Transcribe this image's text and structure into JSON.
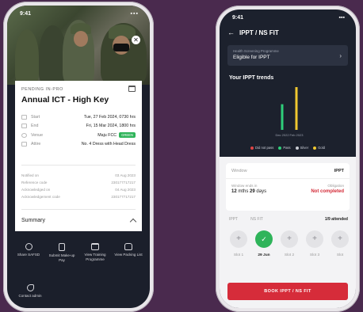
{
  "left_phone": {
    "status_bar": {
      "time": "9:41",
      "signals": "▪▪▪"
    },
    "event": {
      "status": "PENDING IN-PRO",
      "title": "Annual ICT - High Key",
      "details": [
        {
          "label": "Start",
          "value": "Tue, 27 Feb 2024, 0730 hrs"
        },
        {
          "label": "End",
          "value": "Fri, 15 Mar 2024, 1800 hrs"
        },
        {
          "label": "Venue",
          "value": "Maju FCC",
          "badge": "GREEN"
        },
        {
          "label": "Attire",
          "value": "No. 4 Dress with Head Dress"
        }
      ],
      "meta": [
        {
          "label": "Notified on",
          "value": "03 Aug 2023"
        },
        {
          "label": "Reference code",
          "value": "230177717217"
        },
        {
          "label": "Acknowledged on",
          "value": "04 Aug 2023"
        },
        {
          "label": "Acknowledgement code",
          "value": "230177717217"
        }
      ],
      "summary_label": "Summary"
    },
    "actions": [
      {
        "label": "Share SAFSD",
        "icon": "share-icon"
      },
      {
        "label": "Submit Make-up Pay",
        "icon": "receipt-icon"
      },
      {
        "label": "View Training Programme",
        "icon": "calendar-icon"
      },
      {
        "label": "View Packing List",
        "icon": "bag-icon"
      }
    ],
    "contact": {
      "label": "Contact admin",
      "icon": "phone-icon"
    }
  },
  "right_phone": {
    "status_bar": {
      "time": "9:41",
      "signals": "▪▪▪"
    },
    "header": {
      "back": "←",
      "title": "IPPT / NS FIT"
    },
    "health_scheme": {
      "subtitle": "Health Screening Programme",
      "title": "Eligible for IPPT"
    },
    "trends_title": "Your IPPT trends",
    "chart_data": {
      "type": "bar",
      "categories": [
        "Dec 2022",
        "Feb 2023"
      ],
      "series": [
        {
          "name": "Pass",
          "values": [
            1,
            null
          ]
        },
        {
          "name": "Gold",
          "values": [
            null,
            1
          ]
        }
      ],
      "colors": {
        "Did not pass": "#e04545",
        "Pass": "#2fcf7a",
        "Silver": "#c9ccd4",
        "Gold": "#f0c830"
      },
      "legend": [
        "Did not pass",
        "Pass",
        "Silver",
        "Gold"
      ]
    },
    "window_card": {
      "label": "Window",
      "value": "IPPT",
      "ends_label": "Window ends in",
      "ends_months": "12",
      "ends_months_unit": "mths",
      "ends_days": "29",
      "ends_days_unit": "days",
      "obligation_label": "Obligation",
      "obligation_value": "Not completed"
    },
    "tabs": [
      "IPPT",
      "NS FIT"
    ],
    "attended": "1/9 attended",
    "slots": [
      {
        "label": "Slot 1",
        "done": false
      },
      {
        "label": "29 Jun",
        "done": true
      },
      {
        "label": "Slot 2",
        "done": false
      },
      {
        "label": "Slot 3",
        "done": false
      },
      {
        "label": "Slot",
        "done": false
      }
    ],
    "cta_label": "BOOK IPPT / NS FIT"
  }
}
